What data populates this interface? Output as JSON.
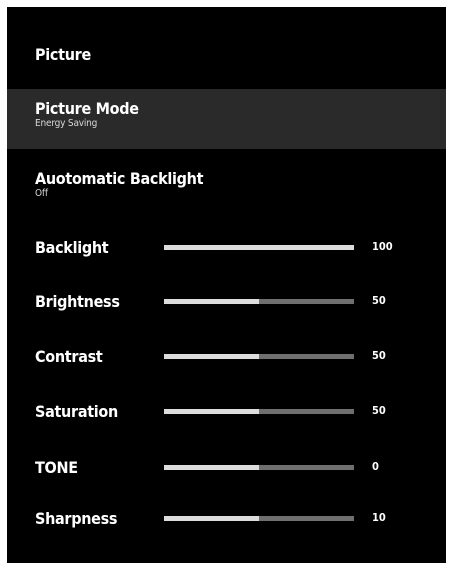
{
  "header": {
    "title": "Picture"
  },
  "items": [
    {
      "label": "Picture Mode",
      "value": "Energy Saving",
      "selected": true
    },
    {
      "label": "Auotomatic Backlight",
      "value": "Off",
      "selected": false
    }
  ],
  "sliders": [
    {
      "label": "Backlight",
      "value": "100",
      "fill": 1.0
    },
    {
      "label": "Brightness",
      "value": "50",
      "fill": 0.5
    },
    {
      "label": "Contrast",
      "value": "50",
      "fill": 0.5
    },
    {
      "label": "Saturation",
      "value": "50",
      "fill": 0.5
    },
    {
      "label": "TONE",
      "value": "0",
      "fill": 0.5
    },
    {
      "label": "Sharpness",
      "value": "10",
      "fill": 0.5
    }
  ],
  "colors": {
    "background": "#000000",
    "selected_row": "#2a2a2a",
    "track": "#6f6f6f",
    "fill": "#dcdcdc",
    "text": "#ffffff"
  }
}
